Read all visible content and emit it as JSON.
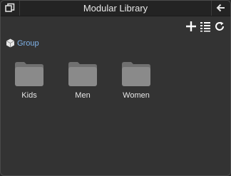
{
  "window": {
    "title": "Modular Library"
  },
  "icons": {
    "restore": "window-restore-icon",
    "back": "arrow-left-icon",
    "add": "plus-icon",
    "list": "list-view-icon",
    "refresh": "refresh-icon",
    "group": "cube-icon",
    "folder": "folder-icon"
  },
  "breadcrumb": {
    "label": "Group"
  },
  "folders": [
    {
      "label": "Kids"
    },
    {
      "label": "Men"
    },
    {
      "label": "Women"
    }
  ],
  "colors": {
    "background": "#333333",
    "titlebar": "#232323",
    "link": "#7fb2e8",
    "folder": "#8a8a8a"
  }
}
